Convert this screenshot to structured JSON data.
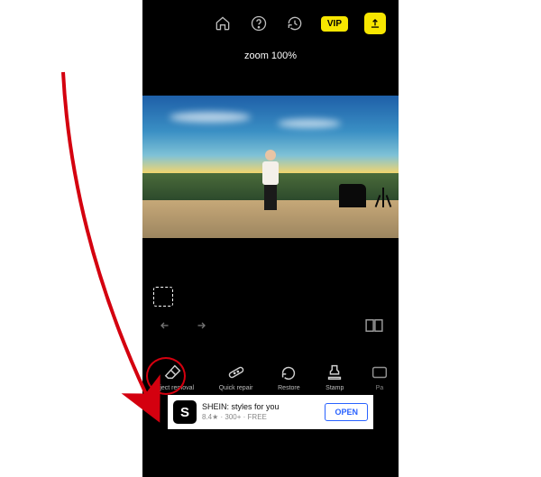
{
  "topbar": {
    "vip_label": "VIP"
  },
  "zoom": {
    "text": "zoom 100%"
  },
  "tools": {
    "object_removal": "Object removal",
    "quick_repair": "Quick repair",
    "restore": "Restore",
    "stamp": "Stamp",
    "partial": "Pa"
  },
  "ad": {
    "logo_letter": "S",
    "line1": "SHEIN: styles for you",
    "line2": "8.4★ · 300+ · FREE",
    "cta": "OPEN"
  }
}
